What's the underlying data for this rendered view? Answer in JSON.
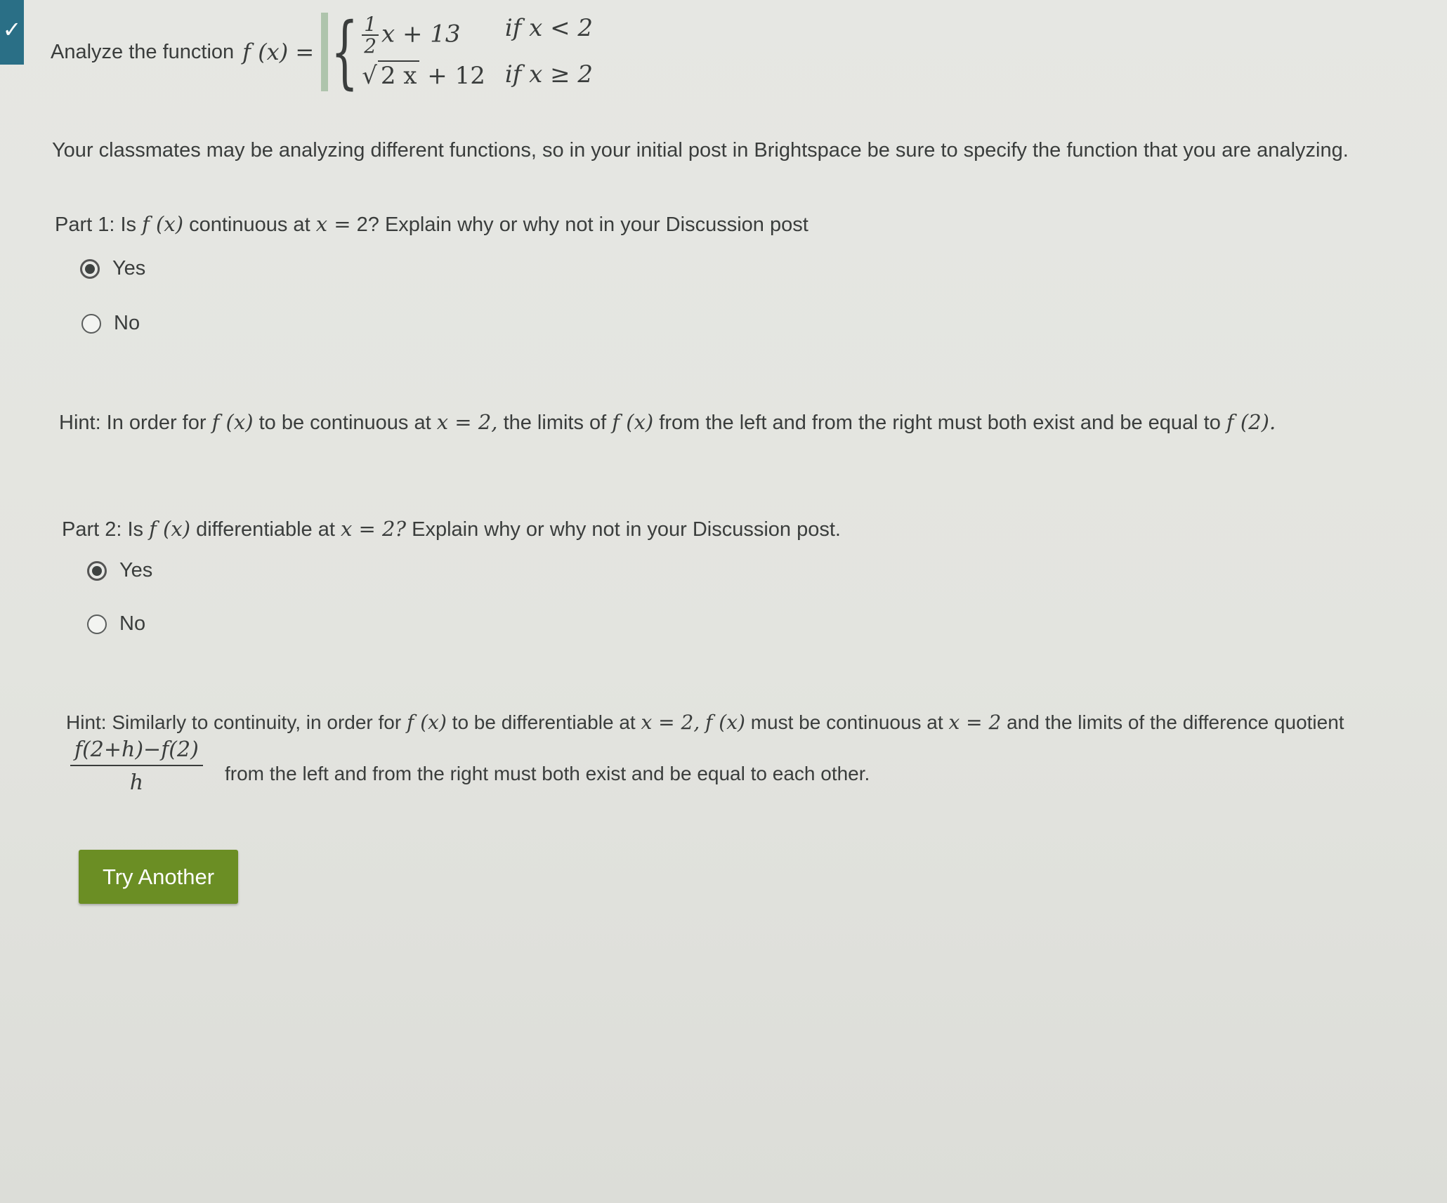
{
  "status": {
    "icon": "checkmark-icon"
  },
  "question": {
    "intro": "Analyze the function",
    "func": "f (x) =",
    "case1_frac_num": "1",
    "case1_frac_den": "2",
    "case1_expr": "x + 13",
    "case1_cond": "if  x < 2",
    "case2_sqrt": "2 x",
    "case2_expr": "+ 12",
    "case2_cond": "if  x ≥ 2"
  },
  "note": "Your classmates may be analyzing different functions, so in your initial post in Brightspace be sure to specify the function that you are analyzing.",
  "part1": {
    "prefix": "Part 1: Is",
    "fx": "f (x)",
    "mid": "continuous at",
    "xeq": "x  =",
    "suffix": "2? Explain why or why not in your Discussion post",
    "options": [
      {
        "label": "Yes",
        "selected": true
      },
      {
        "label": "No",
        "selected": false
      }
    ],
    "hint_prefix": "Hint: In order for",
    "hint_fx": "f (x)",
    "hint_mid1": "to be continuous at",
    "hint_xeq": "x = 2,",
    "hint_mid2": "the limits of",
    "hint_fx2": "f (x)",
    "hint_mid3": "from the left and from the right must both exist and be equal to",
    "hint_f2": "f (2)."
  },
  "part2": {
    "prefix": "Part 2: Is",
    "fx": "f (x)",
    "mid": "differentiable at",
    "xeq": "x = 2?",
    "suffix": "Explain why or why not in your Discussion post.",
    "options": [
      {
        "label": "Yes",
        "selected": true
      },
      {
        "label": "No",
        "selected": false
      }
    ],
    "hint_prefix": "Hint: Similarly to continuity, in order for",
    "hint_fx": "f (x)",
    "hint_mid1": "to be differentiable at",
    "hint_xeq": "x = 2,",
    "hint_fx2": "f (x)",
    "hint_mid2": "must be continuous at",
    "hint_xeq2": "x = 2",
    "hint_mid3": "and the limits of the difference quotient",
    "dq_num": "f(2+h)−f(2)",
    "dq_den": "h",
    "hint_end": "from the left and from the right must both exist and be equal to each other."
  },
  "actions": {
    "try_another": "Try Another"
  }
}
